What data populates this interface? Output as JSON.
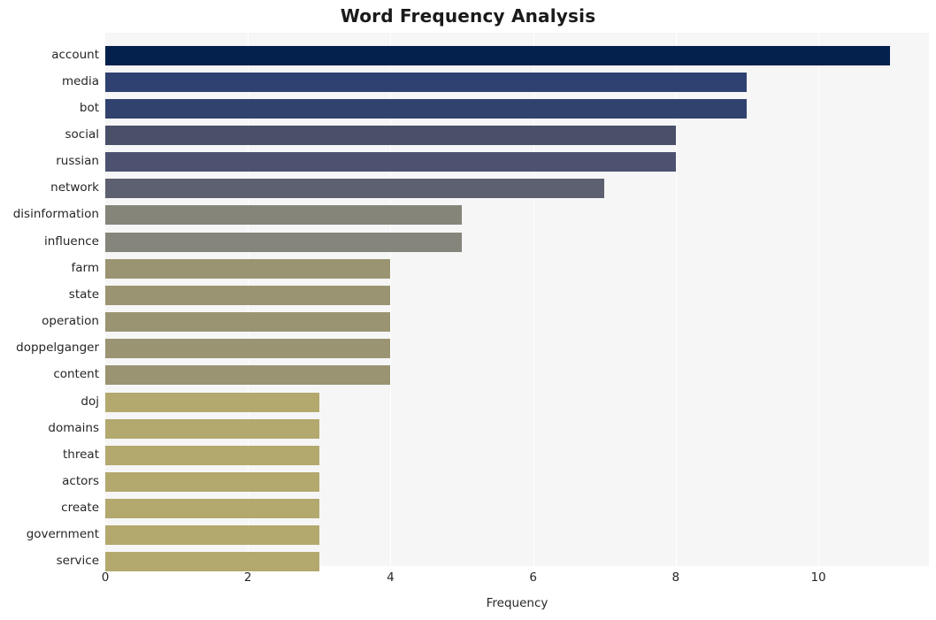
{
  "chart_data": {
    "type": "bar",
    "orientation": "horizontal",
    "title": "Word Frequency Analysis",
    "xlabel": "Frequency",
    "ylabel": "",
    "categories": [
      "account",
      "media",
      "bot",
      "social",
      "russian",
      "network",
      "disinformation",
      "influence",
      "farm",
      "state",
      "operation",
      "doppelganger",
      "content",
      "doj",
      "domains",
      "threat",
      "actors",
      "create",
      "government",
      "service"
    ],
    "values": [
      11,
      9,
      9,
      8,
      8,
      7,
      5,
      5,
      4,
      4,
      4,
      4,
      4,
      3,
      3,
      3,
      3,
      3,
      3,
      3
    ],
    "bar_colors": [
      "#03214c",
      "#2f4170",
      "#32426e",
      "#4a5068",
      "#4c5270",
      "#5d6070",
      "#85857a",
      "#85857b",
      "#9a9472",
      "#9a9472",
      "#9a9472",
      "#9a9472",
      "#9a9472",
      "#b3a86d",
      "#b3a86d",
      "#b3a86d",
      "#b3a86d",
      "#b3a86d",
      "#b3a86d",
      "#b3a86d"
    ],
    "xlim": [
      0,
      11.55
    ],
    "x_ticks": [
      0,
      2,
      4,
      6,
      8,
      10
    ],
    "x_tick_labels": [
      "0",
      "2",
      "4",
      "6",
      "8",
      "10"
    ],
    "grid": "vertical-white",
    "legend": null,
    "plot_background": "#f6f6f7",
    "figure_background": "#ffffff",
    "title_color": "#1a1a1a",
    "tick_label_color": "#262626"
  }
}
